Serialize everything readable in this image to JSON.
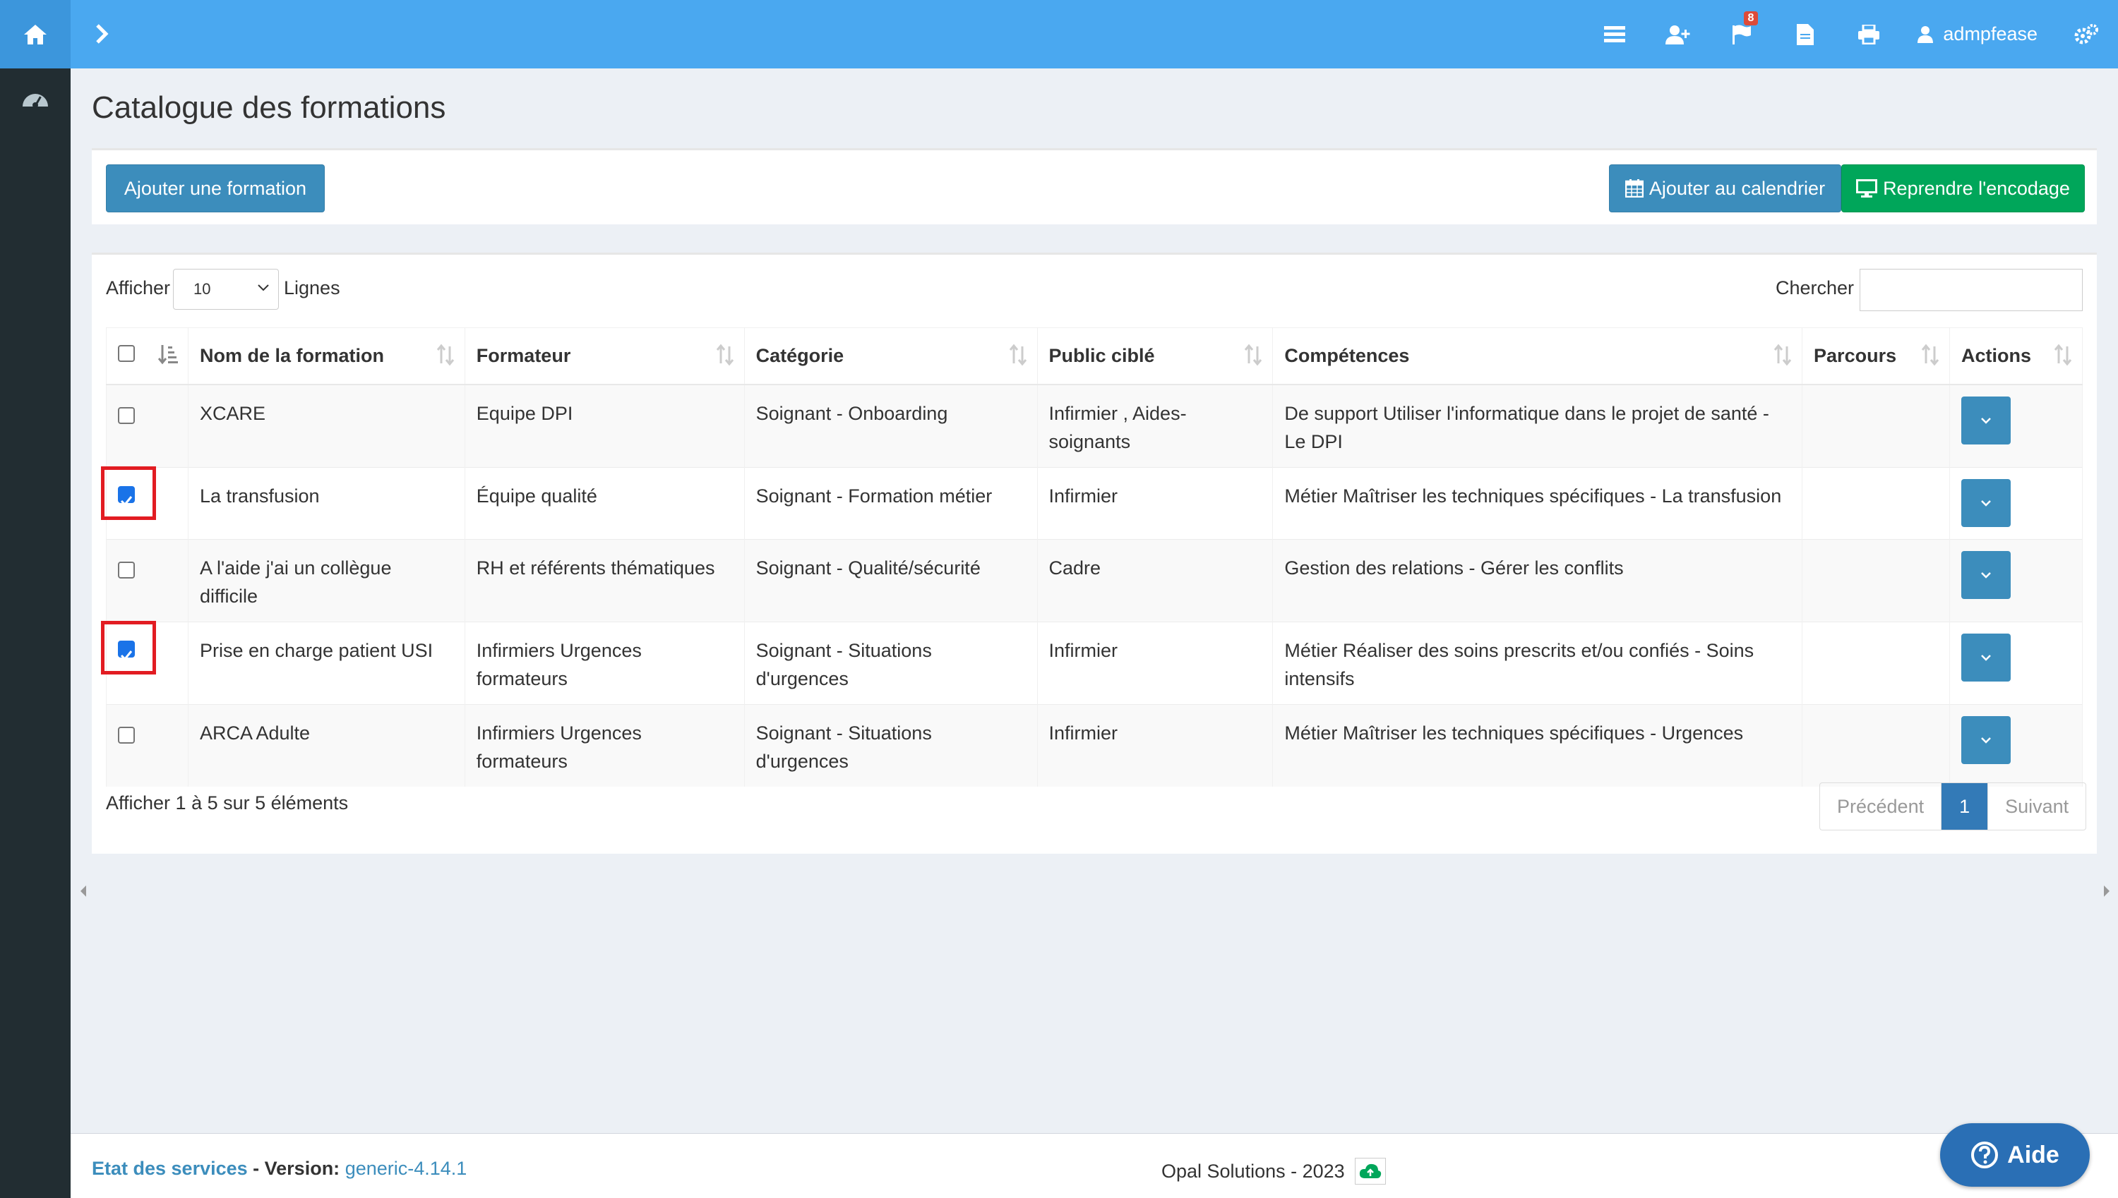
{
  "header": {
    "user_name": "admpfease",
    "notification_count": "8",
    "icons": [
      "home-icon",
      "chevron-right-icon",
      "list-icon",
      "user-plus-icon",
      "flag-icon",
      "file-icon",
      "print-icon",
      "user-icon",
      "cogs-icon"
    ]
  },
  "sidebar": {
    "icons": [
      "dashboard-icon"
    ]
  },
  "page": {
    "title": "Catalogue des formations"
  },
  "toolbar": {
    "add_label": "Ajouter une formation",
    "calendar_label": "Ajouter au calendrier",
    "resume_label": "Reprendre l'encodage"
  },
  "table_controls": {
    "show_label": "Afficher",
    "rows_value": "10",
    "rows_label": "Lignes",
    "search_label": "Chercher",
    "search_value": ""
  },
  "table": {
    "columns": [
      "Nom de la formation",
      "Formateur",
      "Catégorie",
      "Public ciblé",
      "Compétences",
      "Parcours",
      "Actions"
    ],
    "rows": [
      {
        "checked": false,
        "name": "XCARE",
        "trainer": "Equipe DPI",
        "category": "Soignant - Onboarding",
        "audience": "Infirmier , Aides-soignants",
        "skills": "De support Utiliser l'informatique dans le projet de santé - Le DPI",
        "path": ""
      },
      {
        "checked": true,
        "name": "La transfusion",
        "trainer": "Équipe qualité",
        "category": "Soignant - Formation métier",
        "audience": "Infirmier",
        "skills": "Métier Maîtriser les techniques spécifiques - La transfusion",
        "path": ""
      },
      {
        "checked": false,
        "name": "A l'aide j'ai un collègue difficile",
        "trainer": "RH et référents thématiques",
        "category": "Soignant - Qualité/sécurité",
        "audience": "Cadre",
        "skills": "Gestion des relations - Gérer les conflits",
        "path": ""
      },
      {
        "checked": true,
        "name": "Prise en charge patient USI",
        "trainer": "Infirmiers Urgences formateurs",
        "category": "Soignant - Situations d'urgences",
        "audience": "Infirmier",
        "skills": "Métier Réaliser des soins prescrits et/ou confiés - Soins intensifs",
        "path": ""
      },
      {
        "checked": false,
        "name": "ARCA Adulte",
        "trainer": "Infirmiers Urgences formateurs",
        "category": "Soignant - Situations d'urgences",
        "audience": "Infirmier",
        "skills": "Métier Maîtriser les techniques spécifiques - Urgences",
        "path": ""
      }
    ]
  },
  "pagination": {
    "info": "Afficher 1 à 5 sur 5 éléments",
    "prev": "Précédent",
    "current": "1",
    "next": "Suivant"
  },
  "footer": {
    "status_link": "Etat des services",
    "version_label": " - Version: ",
    "version": "generic-4.14.1",
    "copyright": "Opal Solutions - 2023"
  },
  "help": {
    "label": "Aide"
  },
  "colors": {
    "topbar": "#4aa8f0",
    "sidebar": "#222d32",
    "primary": "#3c8dbc",
    "success": "#00a65a"
  }
}
